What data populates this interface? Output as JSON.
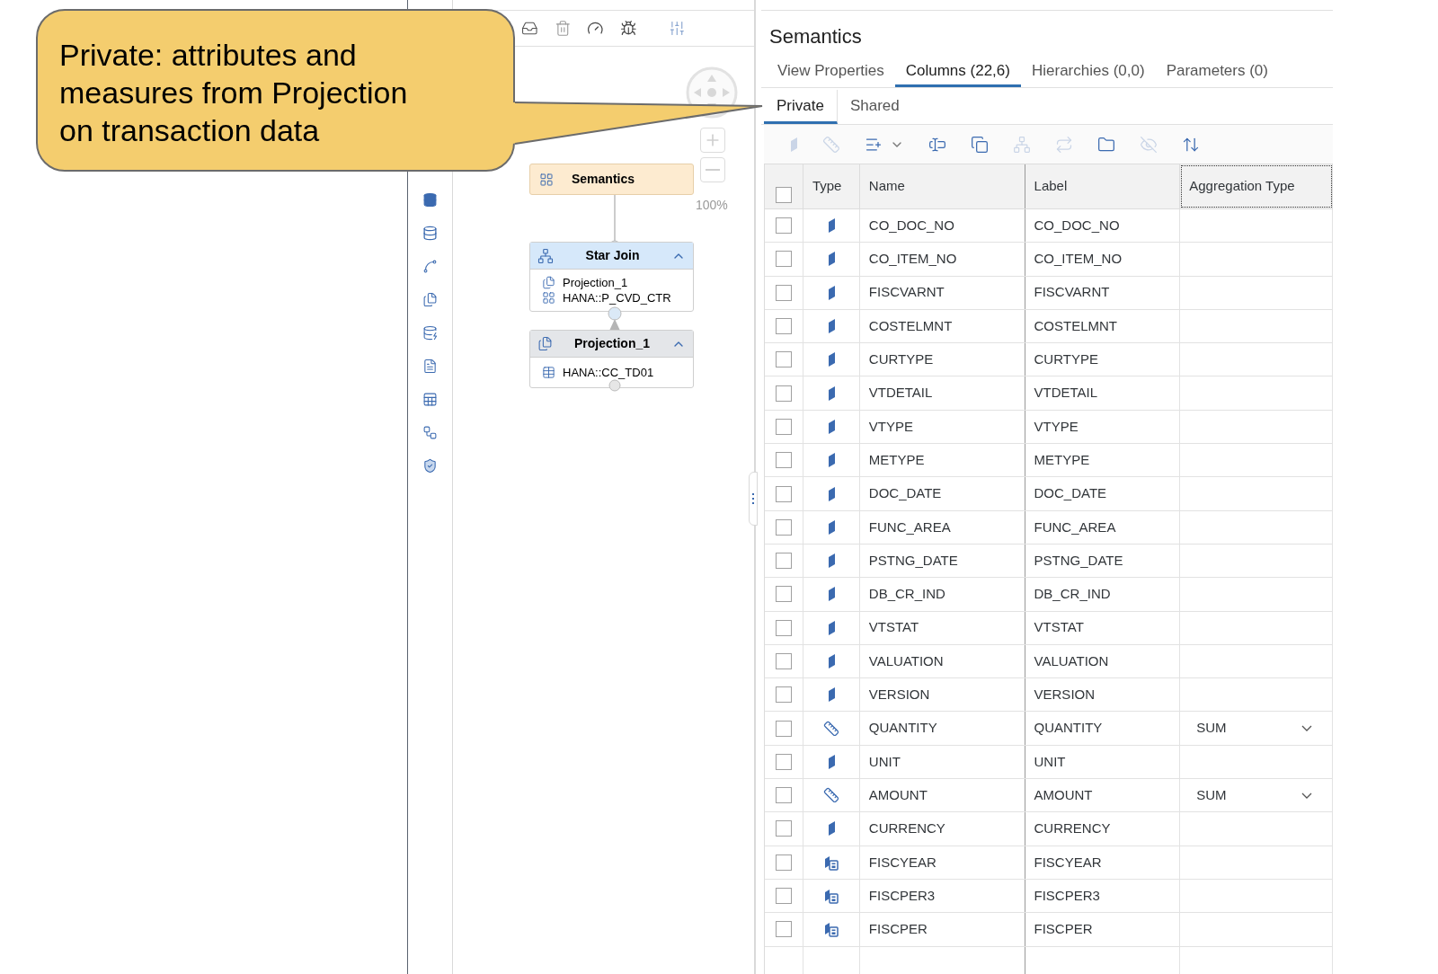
{
  "callout": {
    "text": "Private: attributes and\nmeasures from Projection\non transaction data"
  },
  "canvas": {
    "zoom_label": "100%",
    "semantics_node": {
      "title": "Semantics"
    },
    "star_join_node": {
      "title": "Star Join",
      "inputs": [
        {
          "kind": "projection",
          "text": "Projection_1"
        },
        {
          "kind": "view",
          "text": "HANA::P_CVD_CTR"
        }
      ]
    },
    "projection_node": {
      "title": "Projection_1",
      "inputs": [
        {
          "kind": "table",
          "text": "HANA::CC_TD01"
        }
      ]
    }
  },
  "panel": {
    "title": "Semantics",
    "tabs": [
      {
        "label": "View Properties",
        "selected": false
      },
      {
        "label": "Columns (22,6)",
        "selected": true
      },
      {
        "label": "Hierarchies (0,0)",
        "selected": false
      },
      {
        "label": "Parameters (0)",
        "selected": false
      }
    ],
    "subtabs": [
      {
        "label": "Private",
        "selected": true
      },
      {
        "label": "Shared",
        "selected": false
      }
    ],
    "toolbar": [
      {
        "disabled": true
      },
      {
        "disabled": true
      },
      {
        "disabled": false
      },
      {
        "disabled": false
      },
      {
        "disabled": false
      },
      {
        "disabled": true
      },
      {
        "disabled": true
      },
      {
        "disabled": false
      },
      {
        "disabled": true
      },
      {
        "disabled": false
      }
    ],
    "table": {
      "header_checked": false,
      "columns": [
        "Type",
        "Name",
        "Label",
        "Aggregation Type"
      ],
      "rows": [
        {
          "kind": "attribute",
          "name": "CO_DOC_NO",
          "label": "CO_DOC_NO",
          "checked": false
        },
        {
          "kind": "attribute",
          "name": "CO_ITEM_NO",
          "label": "CO_ITEM_NO",
          "checked": false
        },
        {
          "kind": "attribute",
          "name": "FISCVARNT",
          "label": "FISCVARNT",
          "checked": false
        },
        {
          "kind": "attribute",
          "name": "COSTELMNT",
          "label": "COSTELMNT",
          "checked": false
        },
        {
          "kind": "attribute",
          "name": "CURTYPE",
          "label": "CURTYPE",
          "checked": false
        },
        {
          "kind": "attribute",
          "name": "VTDETAIL",
          "label": "VTDETAIL",
          "checked": false
        },
        {
          "kind": "attribute",
          "name": "VTYPE",
          "label": "VTYPE",
          "checked": false
        },
        {
          "kind": "attribute",
          "name": "METYPE",
          "label": "METYPE",
          "checked": false
        },
        {
          "kind": "attribute",
          "name": "DOC_DATE",
          "label": "DOC_DATE",
          "checked": false
        },
        {
          "kind": "attribute",
          "name": "FUNC_AREA",
          "label": "FUNC_AREA",
          "checked": false
        },
        {
          "kind": "attribute",
          "name": "PSTNG_DATE",
          "label": "PSTNG_DATE",
          "checked": false
        },
        {
          "kind": "attribute",
          "name": "DB_CR_IND",
          "label": "DB_CR_IND",
          "checked": false
        },
        {
          "kind": "attribute",
          "name": "VTSTAT",
          "label": "VTSTAT",
          "checked": false
        },
        {
          "kind": "attribute",
          "name": "VALUATION",
          "label": "VALUATION",
          "checked": false
        },
        {
          "kind": "attribute",
          "name": "VERSION",
          "label": "VERSION",
          "checked": false
        },
        {
          "kind": "measure",
          "name": "QUANTITY",
          "label": "QUANTITY",
          "aggregation": "SUM",
          "checked": false
        },
        {
          "kind": "attribute",
          "name": "UNIT",
          "label": "UNIT",
          "checked": false
        },
        {
          "kind": "measure",
          "name": "AMOUNT",
          "label": "AMOUNT",
          "aggregation": "SUM",
          "checked": false
        },
        {
          "kind": "attribute",
          "name": "CURRENCY",
          "label": "CURRENCY",
          "checked": false
        },
        {
          "kind": "calculated",
          "name": "FISCYEAR",
          "label": "FISCYEAR",
          "checked": false
        },
        {
          "kind": "calculated",
          "name": "FISCPER3",
          "label": "FISCPER3",
          "checked": false
        },
        {
          "kind": "calculated",
          "name": "FISCPER",
          "label": "FISCPER",
          "checked": false
        }
      ]
    }
  }
}
